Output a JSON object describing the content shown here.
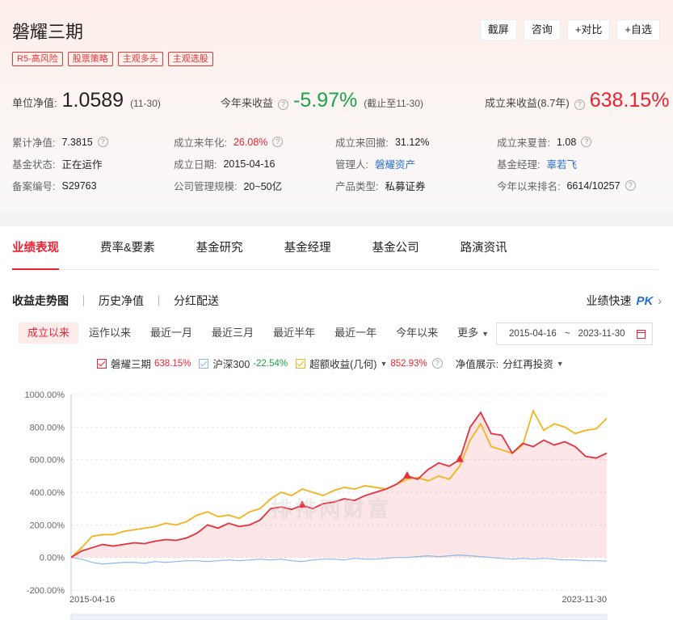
{
  "fund": {
    "name": "磐耀三期",
    "tags": [
      "R5-高风险",
      "股票策略",
      "主观多头",
      "主观选股"
    ],
    "actions": [
      "截屏",
      "咨询",
      "+对比",
      "+自选"
    ]
  },
  "kpis": {
    "nav_label": "单位净值:",
    "nav_value": "1.0589",
    "nav_date": "(11-30)",
    "ytd_label": "今年来收益",
    "ytd_value": "-5.97%",
    "ytd_note": "(截止至11-30)",
    "since_label": "成立来收益(8.7年)",
    "since_value": "638.15%"
  },
  "info": [
    [
      {
        "label": "累计净值:",
        "value": "7.3815",
        "help": true
      },
      {
        "label": "成立来年化:",
        "value": "26.08%",
        "help": true,
        "color": "red"
      },
      {
        "label": "成立来回撤:",
        "value": "31.12%"
      },
      {
        "label": "成立来夏普:",
        "value": "1.08",
        "help": true
      }
    ],
    [
      {
        "label": "基金状态:",
        "value": "正在运作"
      },
      {
        "label": "成立日期:",
        "value": "2015-04-16"
      },
      {
        "label": "管理人:",
        "value": "磐耀资产",
        "color": "blue"
      },
      {
        "label": "基金经理:",
        "value": "辜若飞",
        "color": "blue"
      }
    ],
    [
      {
        "label": "备案编号:",
        "value": "S29763"
      },
      {
        "label": "公司管理规模:",
        "value": "20~50亿"
      },
      {
        "label": "产品类型:",
        "value": "私募证券"
      },
      {
        "label": "今年以来排名:",
        "value": "6614/10257",
        "help": true
      }
    ]
  ],
  "tabs": [
    "业绩表现",
    "费率&要素",
    "基金研究",
    "基金经理",
    "基金公司",
    "路演资讯"
  ],
  "subtabs": [
    "收益走势图",
    "历史净值",
    "分红配送"
  ],
  "quick_label": "业绩快速",
  "quick_pk": "PK",
  "ranges": [
    "成立以来",
    "运作以来",
    "最近一月",
    "最近三月",
    "最近半年",
    "最近一年",
    "今年以来",
    "更多"
  ],
  "date_range": {
    "start": "2015-04-16",
    "end": "2023-11-30"
  },
  "legend": {
    "series": [
      {
        "name": "磐耀三期",
        "value": "638.15%",
        "color": "#e8303c",
        "value_color": "#e23"
      },
      {
        "name": "沪深300",
        "value": "-22.54%",
        "color": "#8fb6e8",
        "value_color": "#1aa34a"
      },
      {
        "name": "超额收益(几何)",
        "value": "852.93%",
        "color": "#f5b21a",
        "value_color": "#e23"
      }
    ],
    "display_label": "净值展示:",
    "display_value": "分红再投资"
  },
  "watermark": "排排网财富",
  "chart_data": {
    "type": "line",
    "x_start": "2015-04-16",
    "x_end": "2023-11-30",
    "ylim": [
      -200,
      1000
    ],
    "yticks": [
      "1000.00%",
      "800.00%",
      "600.00%",
      "400.00%",
      "200.00%",
      "0.00%",
      "-200.00%"
    ],
    "grid": true,
    "series": [
      {
        "name": "磐耀三期",
        "values": [
          0,
          40,
          60,
          80,
          70,
          80,
          90,
          85,
          100,
          110,
          105,
          120,
          150,
          200,
          180,
          210,
          190,
          200,
          230,
          300,
          310,
          295,
          320,
          300,
          330,
          340,
          360,
          350,
          380,
          400,
          420,
          450,
          500,
          480,
          540,
          580,
          560,
          600,
          800,
          890,
          760,
          750,
          640,
          700,
          680,
          720,
          690,
          710,
          680,
          620,
          610,
          640
        ]
      },
      {
        "name": "沪深300",
        "values": [
          0,
          -10,
          -30,
          -40,
          -35,
          -30,
          -30,
          -35,
          -25,
          -30,
          -25,
          -20,
          -20,
          -25,
          -20,
          -15,
          -20,
          -15,
          -10,
          -15,
          -10,
          -20,
          -25,
          -15,
          -10,
          -10,
          -15,
          -5,
          -10,
          -10,
          -5,
          0,
          0,
          5,
          10,
          5,
          10,
          15,
          10,
          5,
          0,
          -5,
          -10,
          -5,
          -10,
          -5,
          -10,
          -15,
          -15,
          -20,
          -20,
          -22.54
        ]
      },
      {
        "name": "超额收益(几何)",
        "values": [
          0,
          60,
          130,
          140,
          140,
          160,
          170,
          180,
          190,
          210,
          200,
          220,
          260,
          280,
          250,
          260,
          240,
          280,
          300,
          360,
          400,
          380,
          420,
          400,
          380,
          410,
          430,
          420,
          440,
          430,
          420,
          450,
          480,
          490,
          470,
          500,
          480,
          560,
          720,
          820,
          680,
          660,
          640,
          690,
          900,
          780,
          820,
          800,
          760,
          780,
          790,
          852.93
        ]
      }
    ],
    "x_labels": [
      "2015-04-16",
      "2023-11-30"
    ]
  }
}
